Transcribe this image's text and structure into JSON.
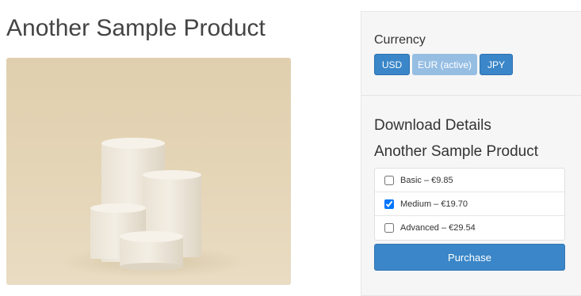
{
  "product": {
    "title": "Another Sample Product",
    "image_alt": "Stacked cylindrical podiums"
  },
  "currency": {
    "label": "Currency",
    "buttons": [
      {
        "label": "USD",
        "active": false
      },
      {
        "label": "EUR (active)",
        "active": true
      },
      {
        "label": "JPY",
        "active": false
      }
    ]
  },
  "download": {
    "heading": "Download Details",
    "product_name": "Another Sample Product",
    "options": [
      {
        "label": "Basic – €9.85",
        "checked": false
      },
      {
        "label": "Medium – €19.70",
        "checked": true
      },
      {
        "label": "Advanced – €29.54",
        "checked": false
      }
    ],
    "purchase_label": "Purchase"
  },
  "colors": {
    "accent": "#3a86c8",
    "active_button": "#96bee3",
    "sidebar_bg": "#f6f6f6",
    "image_bg": "#e3d3b3"
  }
}
